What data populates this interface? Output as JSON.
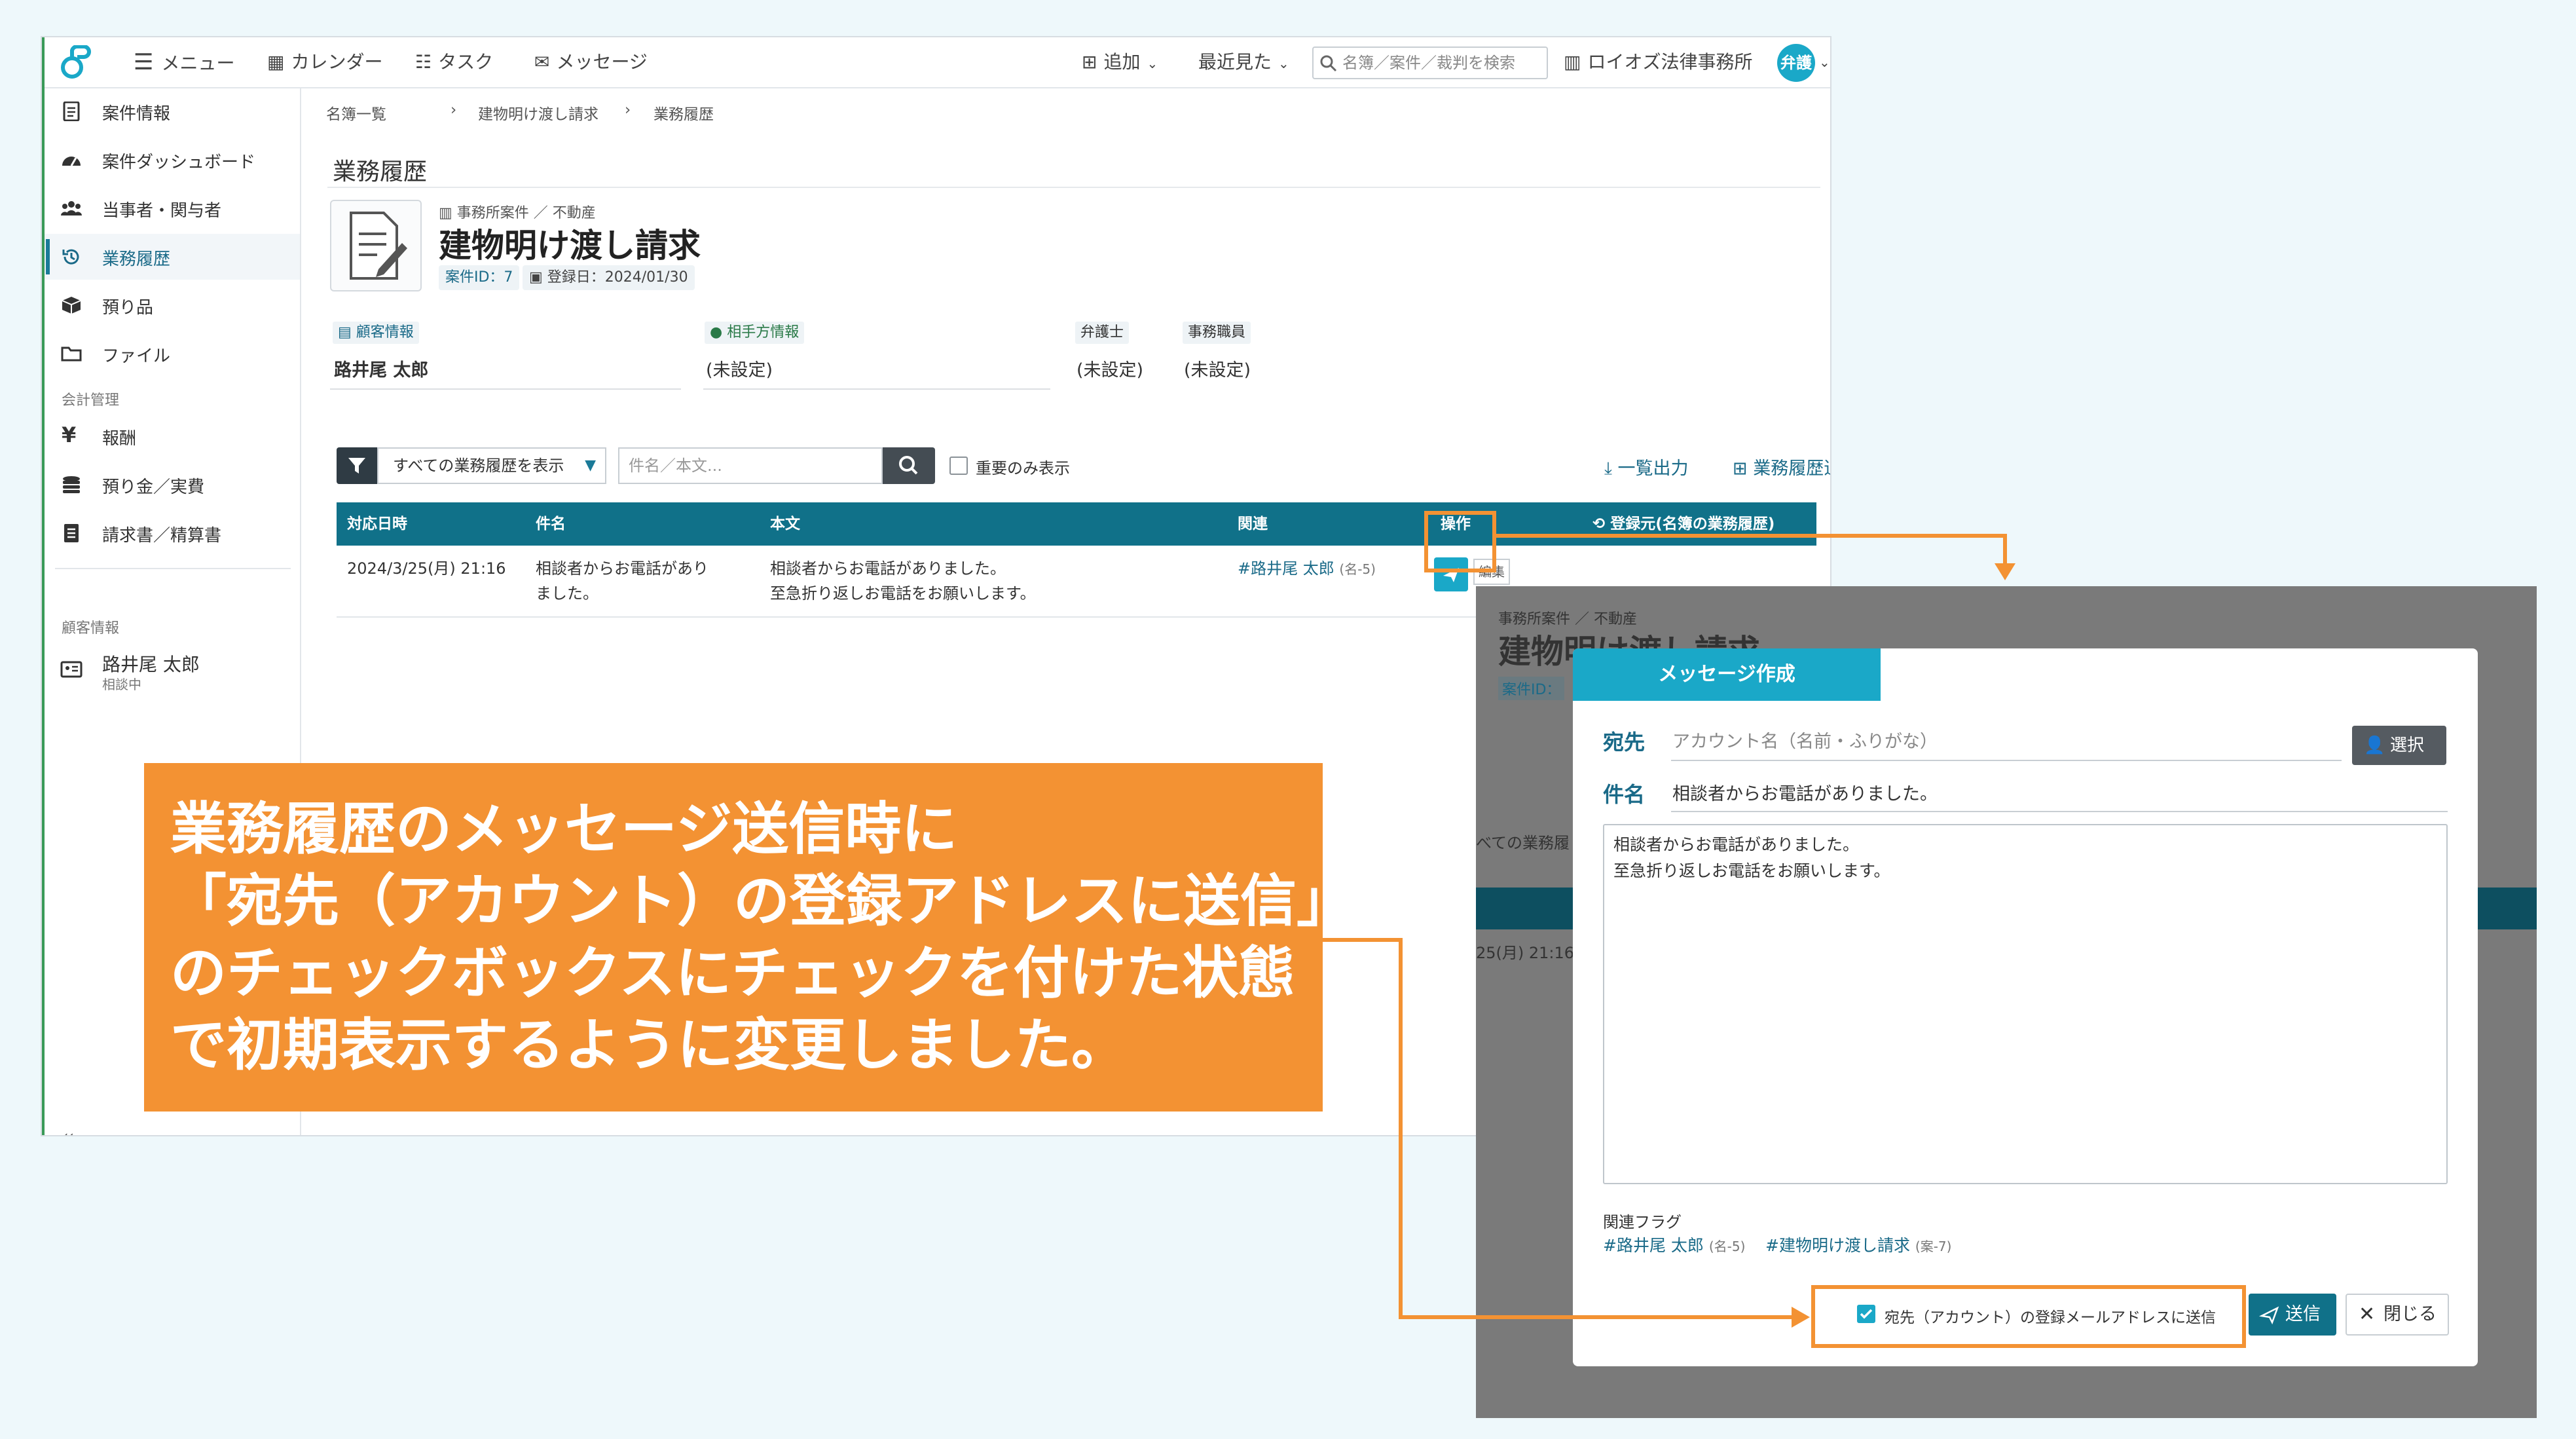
{
  "topbar": {
    "menu": "メニュー",
    "calendar": "カレンダー",
    "task": "タスク",
    "message": "メッセージ",
    "add": "追加",
    "recent": "最近見た",
    "search_placeholder": "名簿／案件／裁判を検索",
    "office": "ロイオズ法律事務所",
    "avatar": "弁護"
  },
  "sidebar": {
    "items": [
      {
        "label": "案件情報",
        "icon": "document-icon"
      },
      {
        "label": "案件ダッシュボード",
        "icon": "dashboard-icon"
      },
      {
        "label": "当事者・関与者",
        "icon": "people-icon"
      },
      {
        "label": "業務履歴",
        "icon": "history-icon"
      },
      {
        "label": "預り品",
        "icon": "box-icon"
      },
      {
        "label": "ファイル",
        "icon": "folder-icon"
      }
    ],
    "section_accounting": "会計管理",
    "accounting_items": [
      {
        "label": "報酬",
        "icon": "yen-icon"
      },
      {
        "label": "預り金／実費",
        "icon": "coins-icon"
      },
      {
        "label": "請求書／精算書",
        "icon": "invoice-icon"
      }
    ],
    "section_client": "顧客情報",
    "client_name": "路井尾 太郎",
    "client_status": "相談中",
    "collapse": "«"
  },
  "breadcrumb": [
    "名簿一覧",
    "建物明け渡し請求",
    "業務履歴"
  ],
  "page": {
    "title": "業務履歴",
    "case_category": "事務所案件 ／ 不動産",
    "case_title": "建物明け渡し請求",
    "case_id": "案件ID：7",
    "registered": "登録日：2024/01/30"
  },
  "info": {
    "client_label": "顧客情報",
    "client_value": "路井尾 太郎",
    "opponent_label": "相手方情報",
    "opponent_value": "(未設定)",
    "lawyer_label": "弁護士",
    "lawyer_value": "(未設定)",
    "staff_label": "事務職員",
    "staff_value": "(未設定)"
  },
  "filter": {
    "select_value": "すべての業務履歴を表示",
    "keyword_placeholder": "件名／本文...",
    "important_only": "重要のみ表示",
    "export": "一覧出力",
    "add_history": "業務履歴追加"
  },
  "table": {
    "headers": [
      "対応日時",
      "件名",
      "本文",
      "関連",
      "操作",
      "登録元(名簿の業務履歴)"
    ],
    "row": {
      "datetime": "2024/3/25(月) 21:16",
      "subject_1": "相談者からお電話があり",
      "subject_2": "ました。",
      "body_1": "相談者からお電話がありました。",
      "body_2": "至急折り返しお電話をお願いします。",
      "related": "#路井尾 太郎",
      "related_note": "(名-5)",
      "edit": "編集"
    }
  },
  "callout": {
    "line1": "業務履歴のメッセージ送信時に",
    "line2": "「宛先（アカウント）の登録アドレスに送信」",
    "line3": "のチェックボックスにチェックを付けた状態",
    "line4": "で初期表示するように変更しました。"
  },
  "popup_bg": {
    "case_category": "事務所案件 ／ 不動産",
    "case_title": "建物明け渡し請求",
    "case_id": "案件ID：",
    "filter_fragment": "べての業務履",
    "date_fragment": "25(月) 21:16"
  },
  "modal": {
    "tab": "メッセージ作成",
    "to_label": "宛先",
    "to_placeholder": "アカウント名（名前・ふりがな）",
    "select": "選択",
    "subject_label": "件名",
    "subject_value": "相談者からお電話がありました。",
    "body": "相談者からお電話がありました。\n至急折り返しお電話をお願いします。",
    "flags_label": "関連フラグ",
    "flag1": "#路井尾 太郎",
    "flag1_note": "(名-5)",
    "flag2": "#建物明け渡し請求",
    "flag2_note": "(案-7)",
    "checkbox_label": "宛先（アカウント）の登録メールアドレスに送信",
    "checkbox_checked": true,
    "send": "送信",
    "close": "閉じる"
  },
  "colors": {
    "accent": "#107189",
    "accent_light": "#1aa8c8",
    "highlight": "#f39233"
  }
}
